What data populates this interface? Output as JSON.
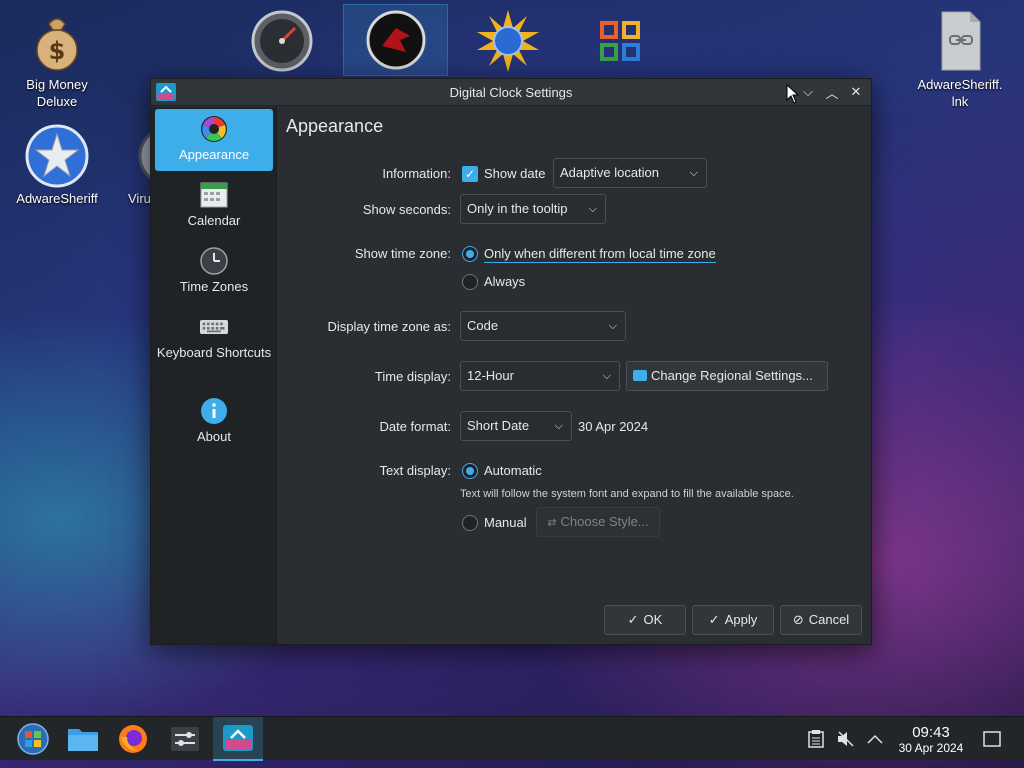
{
  "desktop": {
    "icons": [
      {
        "label": "Big Money Deluxe",
        "icon": "money-bag-icon"
      },
      {
        "label": "AdwareSheriff",
        "icon": "sheriff-star-icon"
      },
      {
        "label": "Viru",
        "icon": "gauge-icon"
      },
      {
        "label": "AdwareSheriff. lnk",
        "icon": "link-file-icon"
      }
    ],
    "top_icons": [
      "speedometer-icon",
      "red-disc-icon",
      "sun-globe-icon",
      "colored-knot-icon"
    ]
  },
  "dialog": {
    "title": "Digital Clock Settings",
    "page_title": "Appearance",
    "sidebar": [
      {
        "label": "Appearance",
        "icon": "color-wheel-icon",
        "selected": true
      },
      {
        "label": "Calendar",
        "icon": "calendar-icon",
        "selected": false
      },
      {
        "label": "Time Zones",
        "icon": "clock-icon",
        "selected": false
      },
      {
        "label": "Keyboard Shortcuts",
        "icon": "keyboard-icon",
        "selected": false
      },
      {
        "label": "About",
        "icon": "info-icon",
        "selected": false
      }
    ],
    "information": {
      "label": "Information:",
      "checkbox_label": "Show date",
      "checked": true,
      "location_value": "Adaptive location"
    },
    "show_seconds": {
      "label": "Show seconds:",
      "value": "Only in the tooltip"
    },
    "show_time_zone": {
      "label": "Show time zone:",
      "option_different": "Only when different from local time zone",
      "option_always": "Always",
      "selected": "different"
    },
    "display_time_zone_as": {
      "label": "Display time zone as:",
      "value": "Code"
    },
    "time_display": {
      "label": "Time display:",
      "value": "12-Hour",
      "regional_button": "Change Regional Settings..."
    },
    "date_format": {
      "label": "Date format:",
      "value": "Short Date",
      "preview": "30 Apr 2024"
    },
    "text_display": {
      "label": "Text display:",
      "option_automatic": "Automatic",
      "hint": "Text will follow the system font and expand to fill the available space.",
      "option_manual": "Manual",
      "choose_style_button": "Choose Style...",
      "selected": "automatic"
    },
    "buttons": {
      "ok": "OK",
      "apply": "Apply",
      "cancel": "Cancel"
    }
  },
  "taskbar": {
    "apps": [
      "start-orb-icon",
      "folder-icon",
      "firefox-icon",
      "settings-sliders-icon",
      "clock-settings-icon"
    ],
    "tray": [
      "clipboard-icon",
      "volume-muted-icon",
      "chevron-up-icon"
    ],
    "clock_time": "09:43",
    "clock_date": "30 Apr 2024"
  },
  "colors": {
    "accent": "#3daee9",
    "window_bg": "#2a2e32",
    "sidebar_bg": "#202326",
    "titlebar_bg": "#31363b"
  }
}
